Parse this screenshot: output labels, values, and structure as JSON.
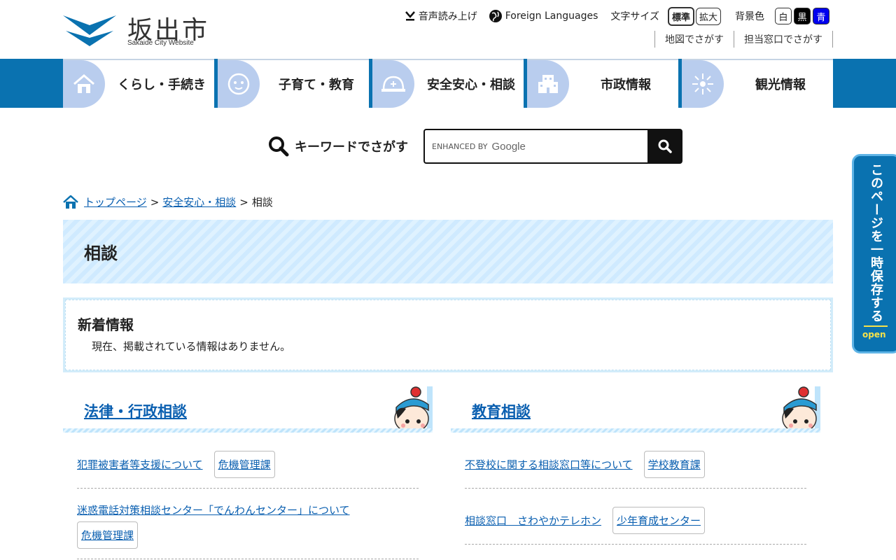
{
  "header": {
    "logo_title": "坂出市",
    "logo_sub": "Sakaide City Website",
    "voice": "音声読み上げ",
    "foreign": "Foreign Languages",
    "font_size_label": "文字サイズ",
    "font_standard": "標準",
    "font_large": "拡大",
    "bg_label": "背景色",
    "bg_white": "白",
    "bg_black": "黒",
    "bg_blue": "青",
    "map_link": "地図でさがす",
    "office_link": "担当窓口でさがす"
  },
  "nav": [
    {
      "label": "くらし・手続き",
      "icon": "house-icon"
    },
    {
      "label": "子育て・教育",
      "icon": "baby-icon"
    },
    {
      "label": "安全安心・相談",
      "icon": "helmet-icon"
    },
    {
      "label": "市政情報",
      "icon": "building-icon"
    },
    {
      "label": "観光情報",
      "icon": "firework-icon"
    }
  ],
  "search": {
    "label": "キーワードでさがす",
    "enhanced": "ENHANCED BY",
    "google": "Google"
  },
  "breadcrumb": {
    "home": "トップページ",
    "parent": "安全安心・相談",
    "current": "相談"
  },
  "page_title": "相談",
  "news": {
    "title": "新着情報",
    "body": "現在、掲載されている情報はありません。"
  },
  "sections": [
    {
      "title": "法律・行政相談",
      "entries": [
        {
          "link": "犯罪被害者等支援について",
          "dept": "危機管理課"
        },
        {
          "link": "迷惑電話対策相談センター「でんわんセンター」について",
          "dept": "危機管理課"
        }
      ]
    },
    {
      "title": "教育相談",
      "entries": [
        {
          "link": "不登校に関する相談窓口等について",
          "dept": "学校教育課"
        },
        {
          "link": "相談窓口　さわやかテレホン",
          "dept": "少年育成センター"
        }
      ]
    }
  ],
  "side_tab": {
    "text": "このページを一時保存する",
    "open": "open"
  },
  "colors": {
    "nav_blue": "#0a72b0",
    "nav_icon_bg": "#b9cdee",
    "link": "#0a5fb0",
    "title_bg": "#cfeaff"
  }
}
